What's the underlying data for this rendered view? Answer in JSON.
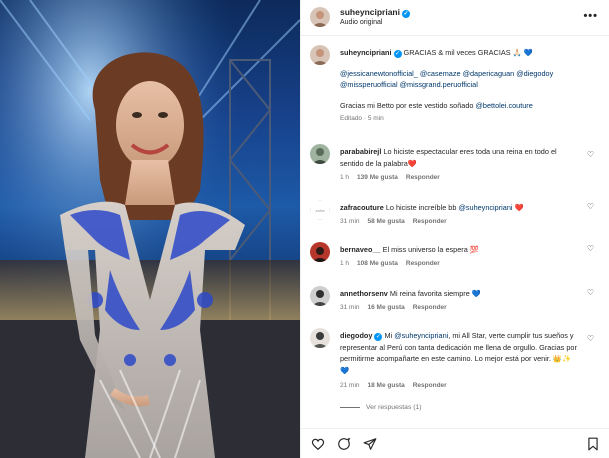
{
  "post": {
    "author": "suheyncipriani",
    "audio": "Audio original",
    "more": "•••",
    "caption": {
      "author": "suheyncipriani",
      "text": "GRACIAS & mil veces GRACIAS 🙏🏻 💙",
      "mentions": "@jessicanewtonofficial_ @casemaze @dapericaguan @diegodoy @missperuofficial @missgrand.peruofficial",
      "thanks": "Gracias mi Betto por este vestido soñado",
      "thanks_mention": "@bettolei.couture",
      "edited": "Editado · 5 min"
    }
  },
  "comments": [
    {
      "user": "parababirejl",
      "text": "Lo hiciste espectacular eres toda una reina en todo el sentido de la palabra❤️",
      "time": "1 h",
      "likes": "139 Me gusta",
      "reply": "Responder"
    },
    {
      "user": "zafracouture",
      "text": "Lo hiciste increíble bb",
      "mention": "@suheyncipriani",
      "text2": "❤️",
      "time": "31 min",
      "likes": "58 Me gusta",
      "reply": "Responder"
    },
    {
      "user": "bernaveo__",
      "text": "El miss universo la espera 💯",
      "time": "1 h",
      "likes": "108 Me gusta",
      "reply": "Responder"
    },
    {
      "user": "annethorsenv",
      "text": "Mi reina favorita siempre 💙",
      "time": "31 min",
      "likes": "16 Me gusta",
      "reply": "Responder"
    },
    {
      "user": "diegodoy",
      "text": "Mi",
      "mention": "@suheyncipriani",
      "text2": ", mi All Star, verte cumplir tus sueños y representar al Perú con tanta dedicación me llena de orgullo. Gracias por permitirme acompañarte en este camino. Lo mejor está por venir. 👑✨💙",
      "time": "21 min",
      "likes": "18 Me gusta",
      "reply": "Responder"
    }
  ],
  "replies_label": "Ver respuestas (1)",
  "footer_icons": [
    "heart-icon",
    "comment-icon",
    "share-icon",
    "bookmark-icon"
  ]
}
